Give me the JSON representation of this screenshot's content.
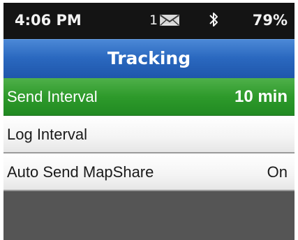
{
  "status_bar": {
    "time": "4:06 PM",
    "message_count": "1",
    "message_icon": "envelope-icon",
    "bluetooth_icon": "bluetooth-icon",
    "battery": "79%"
  },
  "screen": {
    "title": "Tracking"
  },
  "menu": {
    "items": [
      {
        "label": "Send Interval",
        "value": "10 min",
        "selected": true
      },
      {
        "label": "Log Interval",
        "value": "",
        "selected": false
      },
      {
        "label": "Auto Send MapShare",
        "value": "On",
        "selected": false
      }
    ]
  },
  "colors": {
    "status_bar_bg": "#141414",
    "title_bar_blue": "#2a68bf",
    "selected_green": "#2e9a2b",
    "row_bg": "#f4f4f4",
    "empty_bg": "#555555"
  }
}
